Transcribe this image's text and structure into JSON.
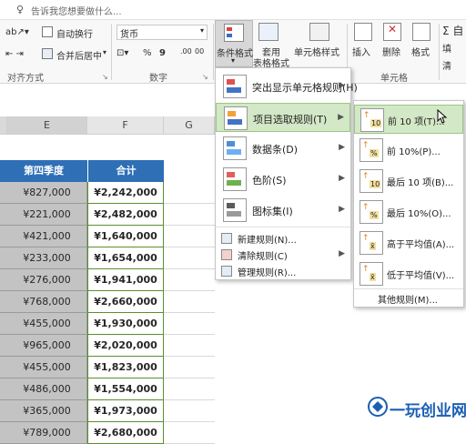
{
  "tellme": {
    "icon": "lightbulb-icon",
    "text": "告诉我您想要做什么..."
  },
  "ribbon": {
    "wrap_text": "自动换行",
    "merge_center": "合并后居中",
    "number_format": "货币",
    "percent": "%",
    "comma": "9",
    "dec_inc": ".00",
    "dec_dec": "00",
    "cond_format": "条件格式",
    "table_format_1": "套用",
    "table_format_2": "表格格式",
    "cell_style": "单元格样式",
    "insert": "插入",
    "delete": "删除",
    "format": "格式",
    "sigma_label": "Σ 自",
    "fill_label": "填",
    "clear_label": "清",
    "group_alignment": "对齐方式",
    "group_number": "数字",
    "group_cells": "单元格"
  },
  "sheet": {
    "col_E": "E",
    "col_F": "F",
    "col_G": "G",
    "header_E": "第四季度",
    "header_F": "合计",
    "rows": [
      {
        "e": "¥827,000",
        "f": "¥2,242,000"
      },
      {
        "e": "¥221,000",
        "f": "¥2,482,000"
      },
      {
        "e": "¥421,000",
        "f": "¥1,640,000"
      },
      {
        "e": "¥233,000",
        "f": "¥1,654,000"
      },
      {
        "e": "¥276,000",
        "f": "¥1,941,000"
      },
      {
        "e": "¥768,000",
        "f": "¥2,660,000"
      },
      {
        "e": "¥455,000",
        "f": "¥1,930,000"
      },
      {
        "e": "¥965,000",
        "f": "¥2,020,000"
      },
      {
        "e": "¥455,000",
        "f": "¥1,823,000"
      },
      {
        "e": "¥486,000",
        "f": "¥1,554,000"
      },
      {
        "e": "¥365,000",
        "f": "¥1,973,000"
      },
      {
        "e": "¥789,000",
        "f": "¥2,680,000"
      }
    ]
  },
  "cf_menu": {
    "items": [
      {
        "label": "突出显示单元格规则(H)",
        "icon": "highlight-rules-icon"
      },
      {
        "label": "项目选取规则(T)",
        "icon": "top-bottom-rules-icon"
      },
      {
        "label": "数据条(D)",
        "icon": "data-bars-icon"
      },
      {
        "label": "色阶(S)",
        "icon": "color-scales-icon"
      },
      {
        "label": "图标集(I)",
        "icon": "icon-sets-icon"
      }
    ],
    "small_items": [
      {
        "label": "新建规则(N)...",
        "icon": "new-rule-icon"
      },
      {
        "label": "清除规则(C)",
        "icon": "clear-rules-icon"
      },
      {
        "label": "管理规则(R)...",
        "icon": "manage-rules-icon"
      }
    ]
  },
  "sub_menu": {
    "items": [
      {
        "label": "前 10 项(T)...",
        "icon": "top-10-icon"
      },
      {
        "label": "前 10%(P)...",
        "icon": "top-10-percent-icon"
      },
      {
        "label": "最后 10 项(B)...",
        "icon": "bottom-10-icon"
      },
      {
        "label": "最后 10%(O)...",
        "icon": "bottom-10-percent-icon"
      },
      {
        "label": "高于平均值(A)...",
        "icon": "above-average-icon"
      },
      {
        "label": "低于平均值(V)...",
        "icon": "below-average-icon"
      }
    ],
    "more": "其他规则(M)..."
  },
  "watermark": {
    "text": "一玩创业网"
  },
  "colors": {
    "header_blue": "#2e6fb6",
    "highlight_green": "#d3e8c6",
    "selected_grey": "#c3c3c3",
    "watermark_blue": "#1a5fb4"
  }
}
